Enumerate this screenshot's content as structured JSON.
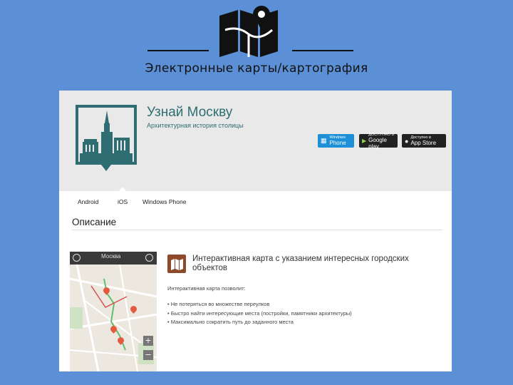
{
  "slide": {
    "subtitle": "Электронные карты/картография"
  },
  "app": {
    "title": "Узнай Москву",
    "subtitle": "Архитектурная история столицы",
    "accent": "#2e6e72",
    "stores": [
      {
        "small": "Windows",
        "large": "Phone",
        "color": "#1e90d8"
      },
      {
        "small": "ДОСТУПНО В",
        "large": "Google play",
        "color": "#222222"
      },
      {
        "small": "Доступно в",
        "large": "App Store",
        "color": "#222222"
      }
    ]
  },
  "tabs": [
    "Android",
    "iOS",
    "Windows Phone"
  ],
  "section_title": "Описание",
  "phone": {
    "city": "Москва",
    "zoom_in": "+",
    "zoom_out": "−"
  },
  "feature": {
    "title": "Интерактивная карта с указанием интересных городских объектов",
    "lead": "Интерактивная карта позволит:",
    "bullets": [
      "• Не потеряться во множестве переулков",
      "• Быстро найти интересующие места (постройки, памятники архитектуры)",
      "• Максимально сократить путь до заданного места"
    ]
  }
}
